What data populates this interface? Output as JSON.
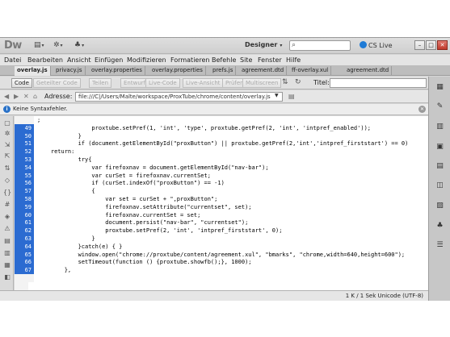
{
  "app": {
    "logo": "Dw",
    "workspace": "Designer",
    "cslive": "CS Live",
    "search_placeholder": ""
  },
  "menu": [
    "Datei",
    "Bearbeiten",
    "Ansicht",
    "Einfügen",
    "Modifizieren",
    "Formatieren",
    "Befehle",
    "Site",
    "Fenster",
    "Hilfe"
  ],
  "tabs": [
    "overlay.js",
    "privacy.js",
    "overlay.properties",
    "overlay.properties",
    "prefs.js",
    "agreement.dtd",
    "ff-overlay.xul",
    "agreement.dtd"
  ],
  "toolbar": {
    "code": "Code",
    "split_code": "Geteilter Code",
    "split": "Teilen",
    "design": "Entwurf",
    "live_code": "Live-Code",
    "live_view": "Live-Ansicht",
    "inspect": "Prüfen",
    "multiscreen": "Multiscreen",
    "title_label": "Titel:",
    "title_value": ""
  },
  "address": {
    "label": "Adresse:",
    "value": "file:///C|/Users/Malte/workspace/ProxTube/chrome/content/overlay.js"
  },
  "info": {
    "message": "Keine Syntaxfehler."
  },
  "code_lines": [
    {
      "n": "",
      "t": ";"
    },
    {
      "n": "49",
      "t": "                proxtube.setPref(1, 'int', 'type', proxtube.getPref(2, 'int', 'intpref_enabled'));"
    },
    {
      "n": "50",
      "t": "            }"
    },
    {
      "n": "51",
      "t": "            if (document.getElementById(\"proxButton\") || proxtube.getPref(2,'int','intpref_firststart') == 0)"
    },
    {
      "n": "52",
      "t": "    return:"
    },
    {
      "n": "53",
      "t": "            try{"
    },
    {
      "n": "54",
      "t": "                var firefoxnav = document.getElementById(\"nav-bar\");"
    },
    {
      "n": "55",
      "t": "                var curSet = firefoxnav.currentSet;"
    },
    {
      "n": "56",
      "t": "                if (curSet.indexOf(\"proxButton\") == -1)"
    },
    {
      "n": "57",
      "t": "                {"
    },
    {
      "n": "58",
      "t": "                    var set = curSet + \",proxButton\";"
    },
    {
      "n": "59",
      "t": "                    firefoxnav.setAttribute(\"currentset\", set);"
    },
    {
      "n": "60",
      "t": "                    firefoxnav.currentSet = set;"
    },
    {
      "n": "61",
      "t": "                    document.persist(\"nav-bar\", \"currentset\");"
    },
    {
      "n": "62",
      "t": "                    proxtube.setPref(2, 'int', 'intpref_firststart', 0);"
    },
    {
      "n": "63",
      "t": "                }"
    },
    {
      "n": "64",
      "t": "            }catch(e) { }"
    },
    {
      "n": "65",
      "t": "            window.open(\"chrome://proxtube/content/agreement.xul\", \"bmarks\", \"chrome,width=640,height=600\");"
    },
    {
      "n": "66",
      "t": "            setTimeout(function () {proxtube.showfb();}, 1000);"
    },
    {
      "n": "67",
      "t": "        },"
    },
    {
      "n": "",
      "t": ""
    }
  ],
  "status": {
    "text": "1 K / 1 Sek  Unicode (UTF-8)"
  }
}
